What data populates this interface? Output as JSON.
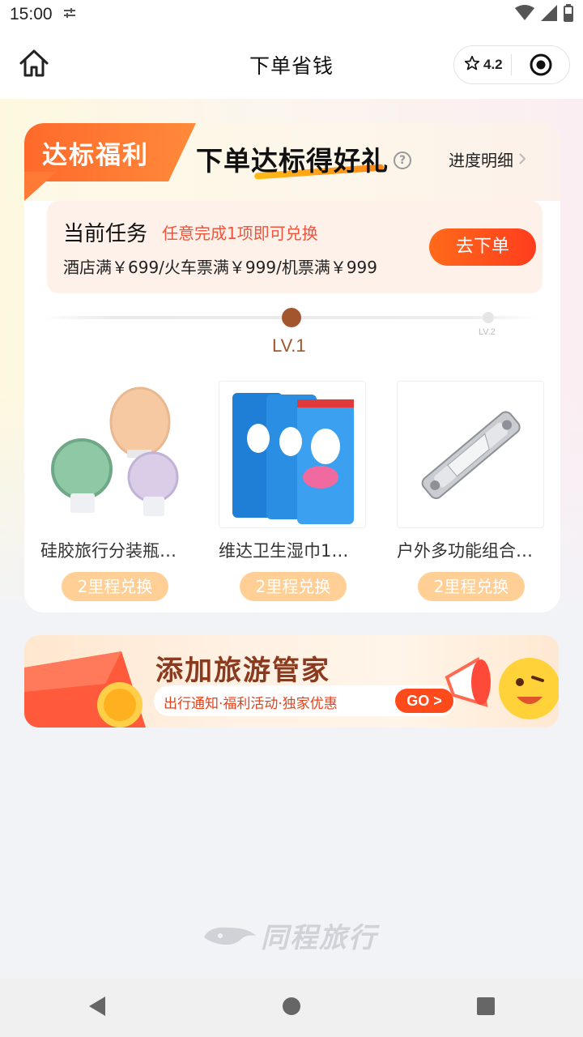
{
  "status_bar": {
    "time": "15:00",
    "icons": [
      "settings-tune-icon",
      "wifi-icon",
      "signal-icon",
      "battery-icon"
    ]
  },
  "header": {
    "home_icon": "home-icon",
    "title": "下单省钱",
    "rating": "4.2",
    "rating_icon": "star-icon",
    "menu_icon": "target-icon"
  },
  "card": {
    "badge": "达标福利",
    "headline": "下单达标得好礼",
    "help_icon": "question-icon",
    "progress_link": "进度明细",
    "task": {
      "label": "当前任务",
      "hint": "任意完成1项即可兑换",
      "conditions": "酒店满￥699/火车票满￥999/机票满￥999",
      "button": "去下单"
    },
    "levels": {
      "current": "LV.1",
      "next": "LV.2"
    },
    "products": [
      {
        "name": "硅胶旅行分装瓶…",
        "redeem": "2里程兑换",
        "image": "silicone-bottles-image"
      },
      {
        "name": "维达卫生湿巾1…",
        "redeem": "2里程兑换",
        "image": "wet-wipes-image"
      },
      {
        "name": "户外多功能组合…",
        "redeem": "2里程兑换",
        "image": "multitool-image"
      }
    ]
  },
  "banner": {
    "title": "添加旅游管家",
    "subtitle": "出行通知·福利活动·独家优惠",
    "go": "GO >"
  },
  "footer": {
    "brand": "同程旅行"
  },
  "colors": {
    "accent_orange": "#ff5a1f",
    "level_brown": "#a2562d",
    "redeem_button": "#ffcf96",
    "hint_red": "#f0543c"
  }
}
